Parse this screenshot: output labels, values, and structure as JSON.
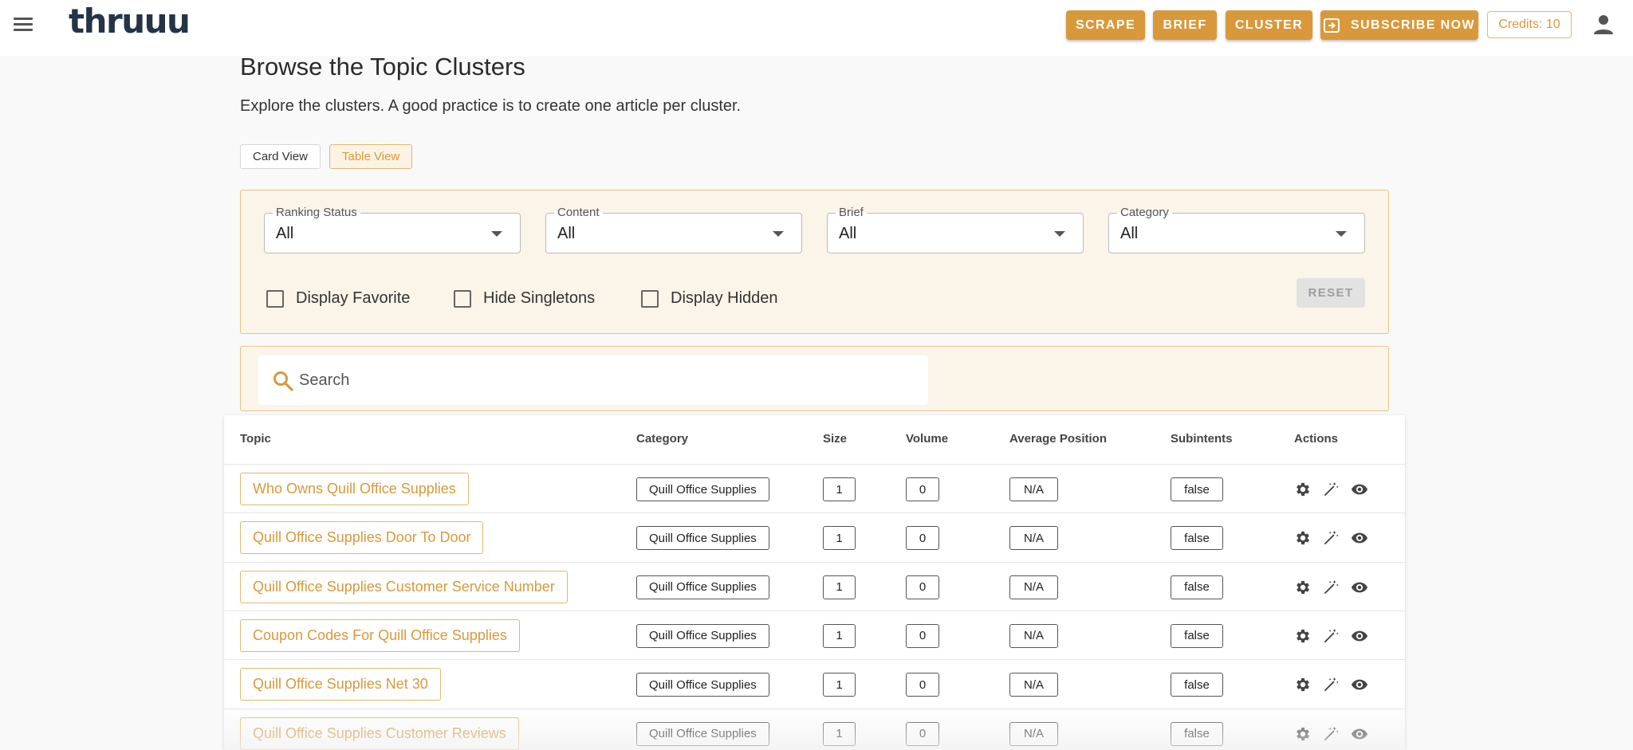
{
  "header": {
    "logo": "thruuu",
    "buttons": [
      "SCRAPE",
      "BRIEF",
      "CLUSTER"
    ],
    "subscribe_label": "SUBSCRIBE NOW",
    "credits": "Credits: 10",
    "accent_color": "#d9993a"
  },
  "page": {
    "title": "Browse the Topic Clusters",
    "subtitle": "Explore the clusters. A good practice is to create one article per cluster.",
    "view_toggle": {
      "card": "Card View",
      "table": "Table View",
      "selected": "Table View"
    }
  },
  "filters": {
    "selects": [
      {
        "label": "Ranking Status",
        "value": "All"
      },
      {
        "label": "Content",
        "value": "All"
      },
      {
        "label": "Brief",
        "value": "All"
      },
      {
        "label": "Category",
        "value": "All"
      }
    ],
    "checkboxes": [
      {
        "label": "Display Favorite",
        "checked": false
      },
      {
        "label": "Hide Singletons",
        "checked": false
      },
      {
        "label": "Display Hidden",
        "checked": false
      }
    ],
    "reset_label": "RESET"
  },
  "search": {
    "placeholder": "Search"
  },
  "table": {
    "columns": [
      "Topic",
      "Category",
      "Size",
      "Volume",
      "Average Position",
      "Subintents",
      "Actions"
    ],
    "rows": [
      {
        "topic": "Who Owns Quill Office Supplies",
        "category": "Quill Office Supplies",
        "size": "1",
        "volume": "0",
        "avg_position": "N/A",
        "subintents": "false"
      },
      {
        "topic": "Quill Office Supplies Door To Door",
        "category": "Quill Office Supplies",
        "size": "1",
        "volume": "0",
        "avg_position": "N/A",
        "subintents": "false"
      },
      {
        "topic": "Quill Office Supplies Customer Service Number",
        "category": "Quill Office Supplies",
        "size": "1",
        "volume": "0",
        "avg_position": "N/A",
        "subintents": "false"
      },
      {
        "topic": "Coupon Codes For Quill Office Supplies",
        "category": "Quill Office Supplies",
        "size": "1",
        "volume": "0",
        "avg_position": "N/A",
        "subintents": "false"
      },
      {
        "topic": "Quill Office Supplies Net 30",
        "category": "Quill Office Supplies",
        "size": "1",
        "volume": "0",
        "avg_position": "N/A",
        "subintents": "false"
      },
      {
        "topic": "Quill Office Supplies Customer Reviews",
        "category": "Quill Office Supplies",
        "size": "1",
        "volume": "0",
        "avg_position": "N/A",
        "subintents": "false"
      }
    ],
    "row_actions": [
      "gear-icon",
      "magic-wand-icon",
      "eye-icon"
    ]
  }
}
